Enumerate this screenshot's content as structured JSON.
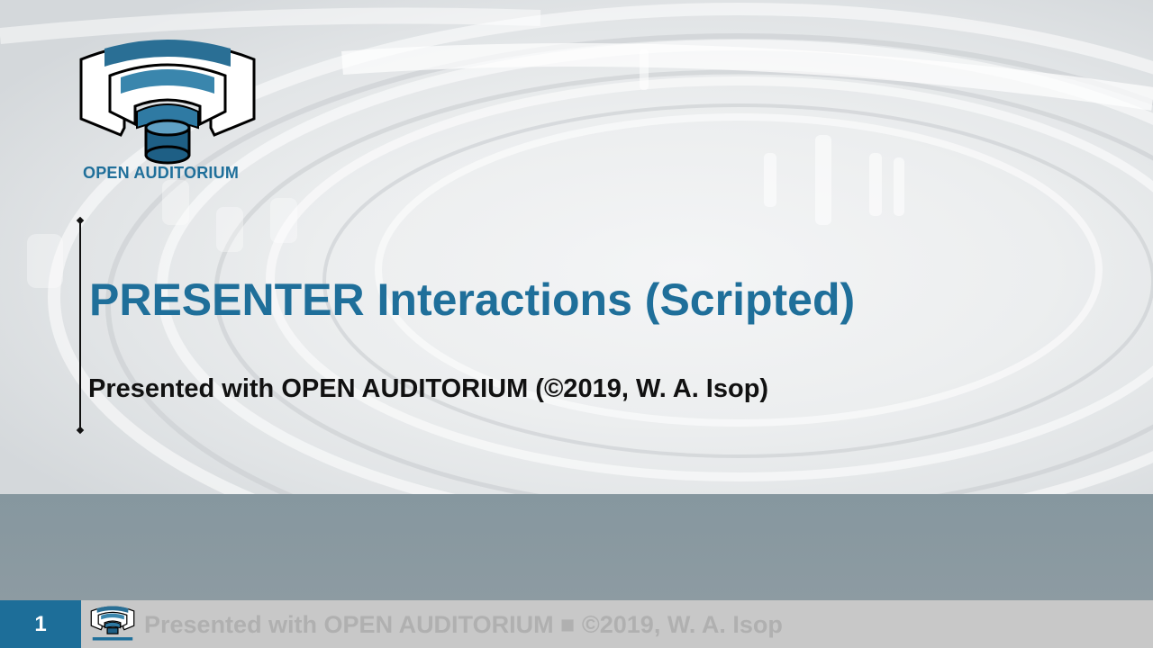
{
  "slide": {
    "logo_text": "OPEN AUDITORIUM",
    "title": "PRESENTER Interactions (Scripted)",
    "subtitle": "Presented with OPEN AUDITORIUM (©2019, W. A. Isop)"
  },
  "footer": {
    "page_number": "1",
    "text": "Presented with OPEN AUDITORIUM ■ ©2019, W. A. Isop"
  },
  "colors": {
    "brand_blue": "#1f6f9a",
    "band_gray": "#8a9aa1",
    "footer_gray": "#c8c8c8"
  },
  "icons": {
    "logo": "open-auditorium-logo-icon"
  }
}
